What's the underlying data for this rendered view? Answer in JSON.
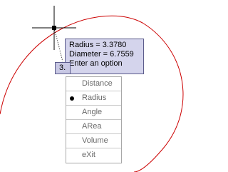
{
  "tooltip": {
    "radius_text": "Radius = 3.3780",
    "diameter_text": "Diameter = 6.7559",
    "prompt_text": "Enter an option"
  },
  "value_input": {
    "value": "3."
  },
  "menu": {
    "items": [
      {
        "label": "Distance",
        "selected": false
      },
      {
        "label": "Radius",
        "selected": true
      },
      {
        "label": "Angle",
        "selected": false
      },
      {
        "label": "ARea",
        "selected": false
      },
      {
        "label": "Volume",
        "selected": false
      },
      {
        "label": "eXit",
        "selected": false
      }
    ]
  },
  "colors": {
    "circle": "#cc0000",
    "crosshair": "#000000",
    "tooltip_bg": "#d4d4ec",
    "menu_text": "#6a6a6a"
  }
}
